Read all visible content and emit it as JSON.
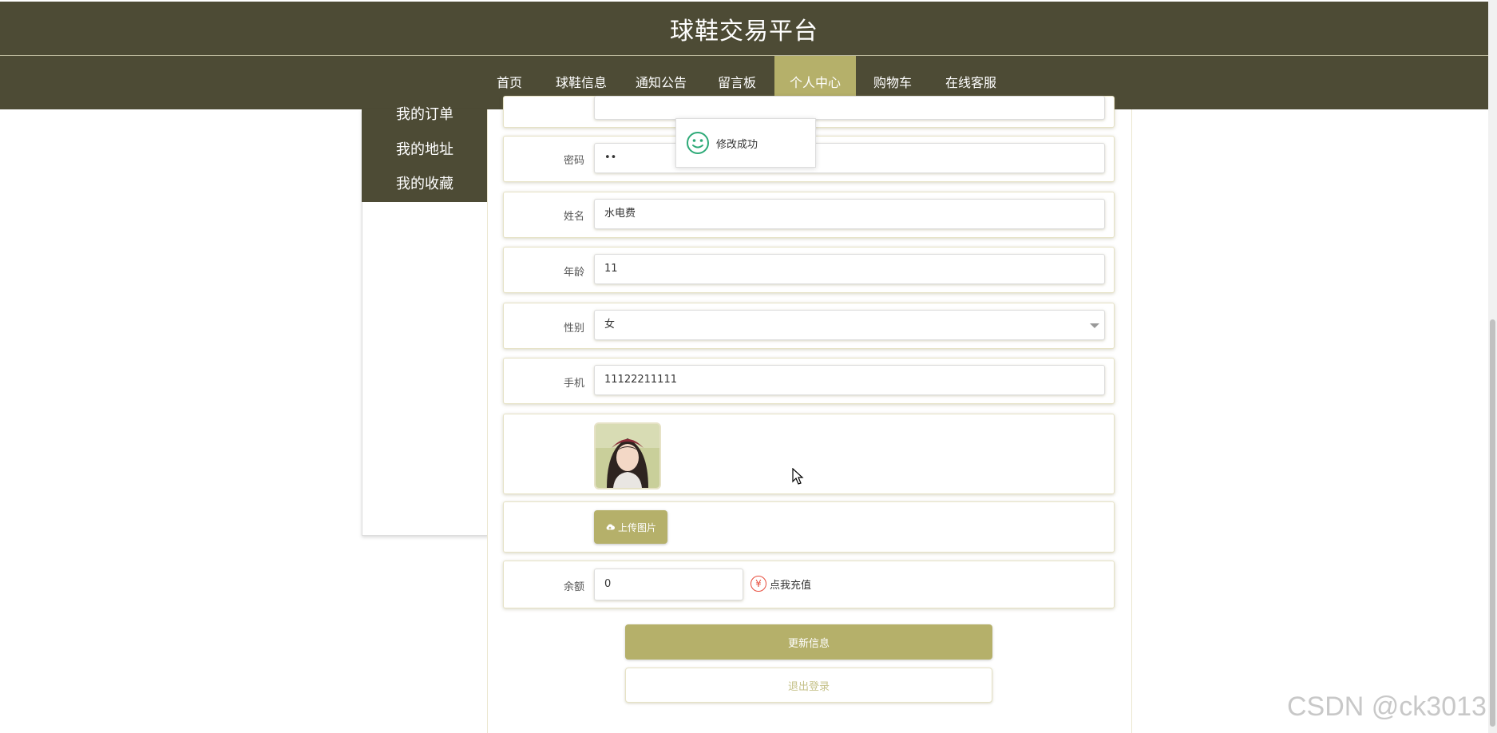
{
  "header": {
    "title": "球鞋交易平台"
  },
  "nav": {
    "items": [
      {
        "label": "首页"
      },
      {
        "label": "球鞋信息"
      },
      {
        "label": "通知公告"
      },
      {
        "label": "留言板"
      },
      {
        "label": "个人中心",
        "active": true
      },
      {
        "label": "购物车"
      },
      {
        "label": "在线客服"
      }
    ]
  },
  "left_menu": {
    "items": [
      {
        "label": "我的订单"
      },
      {
        "label": "我的地址"
      },
      {
        "label": "我的收藏"
      }
    ]
  },
  "form": {
    "password": {
      "label": "密码",
      "value": "••"
    },
    "name": {
      "label": "姓名",
      "value": "水电费"
    },
    "age": {
      "label": "年龄",
      "value": "11"
    },
    "gender": {
      "label": "性别",
      "value": "女"
    },
    "phone": {
      "label": "手机",
      "value": "11122211111"
    },
    "upload_label": "上传图片",
    "balance": {
      "label": "余额",
      "value": "0"
    },
    "recharge_label": "点我充值",
    "recharge_icon": "yen-icon",
    "update_label": "更新信息",
    "logout_label": "退出登录"
  },
  "toast": {
    "message": "修改成功",
    "icon": "smile-icon"
  },
  "watermark": "CSDN @ck3013",
  "colors": {
    "header_bg": "#4d4b35",
    "accent": "#b5b06a",
    "toast_icon": "#2eaa78",
    "recharge_icon": "#e74c3c"
  }
}
